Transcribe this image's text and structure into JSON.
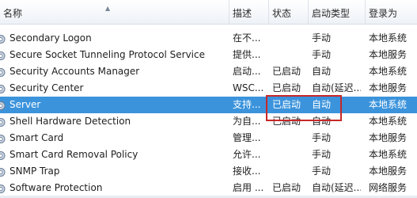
{
  "columns": {
    "name": "名称",
    "desc": "描述",
    "status": "状态",
    "startup": "启动类型",
    "logon": "登录为"
  },
  "icon": "service-gear-icon",
  "selected_color": "#3b93dc",
  "highlight_color": "#c62828",
  "rows": [
    {
      "name": "Secondary Logon",
      "desc": "在不...",
      "status": "",
      "startup": "手动",
      "logon": "本地系统"
    },
    {
      "name": "Secure Socket Tunneling Protocol Service",
      "desc": "提供...",
      "status": "",
      "startup": "手动",
      "logon": "本地服务"
    },
    {
      "name": "Security Accounts Manager",
      "desc": "启动...",
      "status": "已启动",
      "startup": "自动",
      "logon": "本地系统"
    },
    {
      "name": "Security Center",
      "desc": "WSC...",
      "status": "已启动",
      "startup": "自动(延迟...",
      "logon": "本地服务"
    },
    {
      "name": "Server",
      "desc": "支持...",
      "status": "已启动",
      "startup": "自动",
      "logon": "本地系统",
      "selected": true
    },
    {
      "name": "Shell Hardware Detection",
      "desc": "为自...",
      "status": "已启动",
      "startup": "自动",
      "logon": "本地系统"
    },
    {
      "name": "Smart Card",
      "desc": "管理...",
      "status": "",
      "startup": "手动",
      "logon": "本地服务"
    },
    {
      "name": "Smart Card Removal Policy",
      "desc": "允许...",
      "status": "",
      "startup": "手动",
      "logon": "本地系统"
    },
    {
      "name": "SNMP Trap",
      "desc": "接收...",
      "status": "",
      "startup": "手动",
      "logon": "本地服务"
    },
    {
      "name": "Software Protection",
      "desc": "启用 ...",
      "status": "已启动",
      "startup": "自动(延迟...",
      "logon": "网络服务"
    }
  ]
}
